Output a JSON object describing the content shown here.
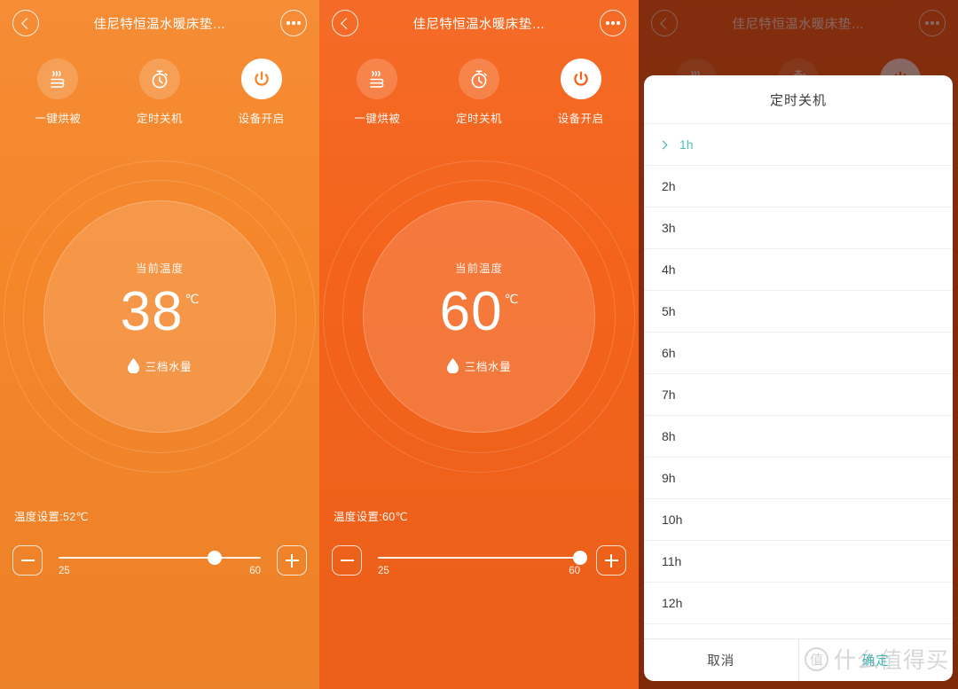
{
  "header": {
    "title": "佳尼特恒温水暖床垫…",
    "back_icon": "chevron-left-icon",
    "more_icon": "more-dots-icon"
  },
  "actions": [
    {
      "label": "一键烘被",
      "icon": "dry-bedding-icon"
    },
    {
      "label": "定时关机",
      "icon": "timer-stopwatch-icon"
    },
    {
      "label": "设备开启",
      "icon": "power-icon"
    }
  ],
  "panel1": {
    "current_label": "当前温度",
    "temperature": "38",
    "unit": "℃",
    "water_level": "三档水量",
    "water_icon": "water-drop-icon",
    "set_text": "温度设置:52℃",
    "slider": {
      "min_label": "25",
      "max_label": "60",
      "value": 52,
      "min": 25,
      "max": 60
    },
    "minus_label": "−",
    "plus_label": "+",
    "bg_color": "#F5862A"
  },
  "panel2": {
    "current_label": "当前温度",
    "temperature": "60",
    "unit": "℃",
    "water_level": "三档水量",
    "water_icon": "water-drop-icon",
    "set_text": "温度设置:60℃",
    "slider": {
      "min_label": "25",
      "max_label": "60",
      "value": 60,
      "min": 25,
      "max": 60
    },
    "minus_label": "−",
    "plus_label": "+",
    "bg_color": "#F4631B"
  },
  "panel3": {
    "bg_color": "#F4631B",
    "dialog": {
      "title": "定时关机",
      "options": [
        {
          "label": "1h",
          "selected": true
        },
        {
          "label": "2h",
          "selected": false
        },
        {
          "label": "3h",
          "selected": false
        },
        {
          "label": "4h",
          "selected": false
        },
        {
          "label": "5h",
          "selected": false
        },
        {
          "label": "6h",
          "selected": false
        },
        {
          "label": "7h",
          "selected": false
        },
        {
          "label": "8h",
          "selected": false
        },
        {
          "label": "9h",
          "selected": false
        },
        {
          "label": "10h",
          "selected": false
        },
        {
          "label": "11h",
          "selected": false
        },
        {
          "label": "12h",
          "selected": false
        }
      ],
      "cancel_label": "取消",
      "confirm_label": "确定",
      "selected_color": "#4FBDBD"
    }
  },
  "watermark": {
    "badge": "值",
    "text": "什么值得买"
  }
}
